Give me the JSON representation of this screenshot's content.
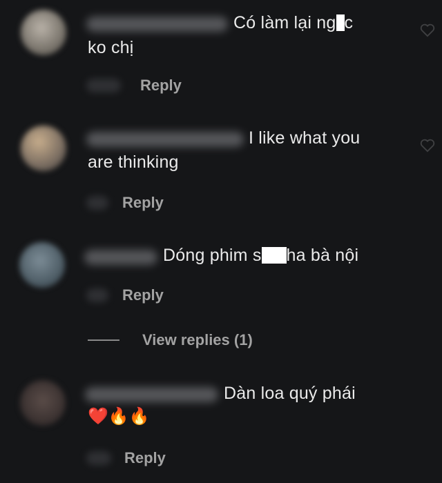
{
  "comments": [
    {
      "text_line1": "Có làm lại ng",
      "text_line1_after": "c",
      "text_line2": "ko chị",
      "reply_label": "Reply"
    },
    {
      "text_line1": "I like what you",
      "text_line2": "are thinking",
      "reply_label": "Reply"
    },
    {
      "text_before": "Dóng phim s",
      "text_after": "ha bà nội",
      "reply_label": "Reply",
      "view_replies_label": "View replies (1)"
    },
    {
      "text_line1": "Dàn loa quý phái",
      "emoji_line": "❤️🔥🔥",
      "reply_label": "Reply"
    }
  ],
  "colors": {
    "background": "#151618",
    "text": "#eaeaea",
    "muted": "#a3a3a3",
    "redaction": "#ffffff"
  },
  "icons": [
    "heart-like-icon"
  ]
}
